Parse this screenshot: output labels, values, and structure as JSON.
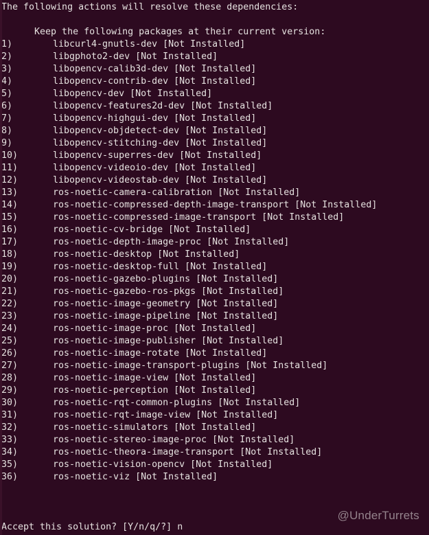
{
  "terminal": {
    "background_color": "#2d0a20",
    "foreground_color": "#e6e2e0",
    "header_line": "The following actions will resolve these dependencies:",
    "blank_line": "",
    "section_heading": "      Keep the following packages at their current version:",
    "state_label": "[Not Installed]",
    "prompt": {
      "question": "Accept this solution? [Y/n/q/?] ",
      "answer": "n"
    },
    "watermark": "@UnderTurrets"
  },
  "packages": [
    {
      "index": "1)",
      "name": "libcurl4-gnutls-dev",
      "state": "[Not Installed]"
    },
    {
      "index": "2)",
      "name": "libgphoto2-dev",
      "state": "[Not Installed]"
    },
    {
      "index": "3)",
      "name": "libopencv-calib3d-dev",
      "state": "[Not Installed]"
    },
    {
      "index": "4)",
      "name": "libopencv-contrib-dev",
      "state": "[Not Installed]"
    },
    {
      "index": "5)",
      "name": "libopencv-dev",
      "state": "[Not Installed]"
    },
    {
      "index": "6)",
      "name": "libopencv-features2d-dev",
      "state": "[Not Installed]"
    },
    {
      "index": "7)",
      "name": "libopencv-highgui-dev",
      "state": "[Not Installed]"
    },
    {
      "index": "8)",
      "name": "libopencv-objdetect-dev",
      "state": "[Not Installed]"
    },
    {
      "index": "9)",
      "name": "libopencv-stitching-dev",
      "state": "[Not Installed]"
    },
    {
      "index": "10)",
      "name": "libopencv-superres-dev",
      "state": "[Not Installed]"
    },
    {
      "index": "11)",
      "name": "libopencv-videoio-dev",
      "state": "[Not Installed]"
    },
    {
      "index": "12)",
      "name": "libopencv-videostab-dev",
      "state": "[Not Installed]"
    },
    {
      "index": "13)",
      "name": "ros-noetic-camera-calibration",
      "state": "[Not Installed]"
    },
    {
      "index": "14)",
      "name": "ros-noetic-compressed-depth-image-transport",
      "state": "[Not Installed]"
    },
    {
      "index": "15)",
      "name": "ros-noetic-compressed-image-transport",
      "state": "[Not Installed]"
    },
    {
      "index": "16)",
      "name": "ros-noetic-cv-bridge",
      "state": "[Not Installed]"
    },
    {
      "index": "17)",
      "name": "ros-noetic-depth-image-proc",
      "state": "[Not Installed]"
    },
    {
      "index": "18)",
      "name": "ros-noetic-desktop",
      "state": "[Not Installed]"
    },
    {
      "index": "19)",
      "name": "ros-noetic-desktop-full",
      "state": "[Not Installed]"
    },
    {
      "index": "20)",
      "name": "ros-noetic-gazebo-plugins",
      "state": "[Not Installed]"
    },
    {
      "index": "21)",
      "name": "ros-noetic-gazebo-ros-pkgs",
      "state": "[Not Installed]"
    },
    {
      "index": "22)",
      "name": "ros-noetic-image-geometry",
      "state": "[Not Installed]"
    },
    {
      "index": "23)",
      "name": "ros-noetic-image-pipeline",
      "state": "[Not Installed]"
    },
    {
      "index": "24)",
      "name": "ros-noetic-image-proc",
      "state": "[Not Installed]"
    },
    {
      "index": "25)",
      "name": "ros-noetic-image-publisher",
      "state": "[Not Installed]"
    },
    {
      "index": "26)",
      "name": "ros-noetic-image-rotate",
      "state": "[Not Installed]"
    },
    {
      "index": "27)",
      "name": "ros-noetic-image-transport-plugins",
      "state": "[Not Installed]"
    },
    {
      "index": "28)",
      "name": "ros-noetic-image-view",
      "state": "[Not Installed]"
    },
    {
      "index": "29)",
      "name": "ros-noetic-perception",
      "state": "[Not Installed]"
    },
    {
      "index": "30)",
      "name": "ros-noetic-rqt-common-plugins",
      "state": "[Not Installed]"
    },
    {
      "index": "31)",
      "name": "ros-noetic-rqt-image-view",
      "state": "[Not Installed]"
    },
    {
      "index": "32)",
      "name": "ros-noetic-simulators",
      "state": "[Not Installed]"
    },
    {
      "index": "33)",
      "name": "ros-noetic-stereo-image-proc",
      "state": "[Not Installed]"
    },
    {
      "index": "34)",
      "name": "ros-noetic-theora-image-transport",
      "state": "[Not Installed]"
    },
    {
      "index": "35)",
      "name": "ros-noetic-vision-opencv",
      "state": "[Not Installed]"
    },
    {
      "index": "36)",
      "name": "ros-noetic-viz",
      "state": "[Not Installed]"
    }
  ]
}
